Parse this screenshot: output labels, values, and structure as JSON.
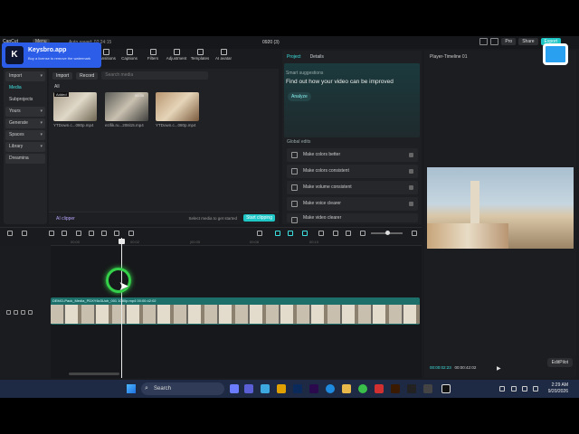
{
  "titlebar": {
    "app_name": "CapCut",
    "menu_label": "Menu",
    "autosave": "Auto saved: 02:24:15",
    "project_name": "0920 (3)",
    "pro_label": "Pro",
    "share_label": "Share",
    "export_label": "Export"
  },
  "tool_tabs": [
    {
      "label": "Effects"
    },
    {
      "label": "Transitions"
    },
    {
      "label": "Captions"
    },
    {
      "label": "Filters"
    },
    {
      "label": "Adjustment"
    },
    {
      "label": "Templates"
    },
    {
      "label": "AI avatar"
    }
  ],
  "sidebar": {
    "items": [
      {
        "label": "Import"
      },
      {
        "label": "Media"
      },
      {
        "label": "Subprojects"
      },
      {
        "label": "Yours"
      },
      {
        "label": "Generate"
      },
      {
        "label": "Spaces"
      },
      {
        "label": "Library"
      },
      {
        "label": "Dreamina"
      }
    ]
  },
  "media": {
    "import_label": "Import",
    "record_label": "Record",
    "search_placeholder": "Search media",
    "filter_label": "All",
    "added_tag": "Added",
    "duration_tag": "00:30",
    "items": [
      {
        "name": "YTDown.c...080p.mp4"
      },
      {
        "name": "ezifik.ru...208i15.mp4"
      },
      {
        "name": "YTDown.c...080p.mp4"
      }
    ],
    "ai_clipper": "AI clipper",
    "footer_hint": "Select media to get started",
    "start_clipping": "Start clipping",
    "try_free": "Try free"
  },
  "inspector": {
    "tab_project": "Project",
    "tab_details": "Details",
    "smart_title": "Smart suggestions",
    "smart_heading": "Find out how your video can be improved",
    "analyze_label": "Analyze",
    "global_title": "Global edits",
    "edits": [
      {
        "label": "Make colors better"
      },
      {
        "label": "Make colors consistent"
      },
      {
        "label": "Make volume consistent"
      },
      {
        "label": "Make voice clearer"
      },
      {
        "label": "Make video clearer"
      }
    ]
  },
  "player": {
    "title": "Player-Timeline 01",
    "current_time": "00:00:02:23",
    "total_time": "00:00:42:02",
    "editpilot_label": "EditPilot"
  },
  "timeline": {
    "ticks": [
      "00:00",
      "00:02",
      "|00:05",
      "00:08",
      "00:10"
    ],
    "clip_label": "DEMO-Pack_Media_PDXY6c3Uoh_001 1080p.mp4  00:00:42:02"
  },
  "keystroke": {
    "logo_letter": "K",
    "title": "Keysbro.app",
    "subtitle": "Buy a license to remove the watermark"
  },
  "taskbar": {
    "search_label": "Search",
    "time": "2:29 AM",
    "date": "9/20/2026"
  }
}
